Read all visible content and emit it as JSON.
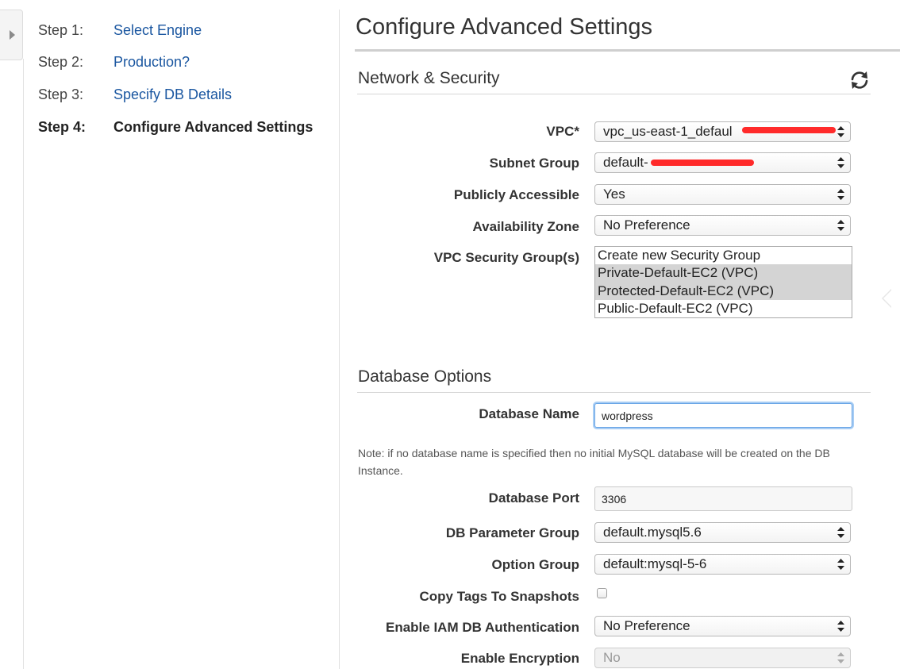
{
  "wizard": {
    "steps": [
      {
        "num": "Step 1:",
        "label": "Select Engine"
      },
      {
        "num": "Step 2:",
        "label": "Production?"
      },
      {
        "num": "Step 3:",
        "label": "Specify DB Details"
      },
      {
        "num": "Step 4:",
        "label": "Configure Advanced Settings"
      }
    ],
    "current_step": 4
  },
  "page": {
    "title": "Configure Advanced Settings"
  },
  "network_security": {
    "title": "Network & Security",
    "refresh_icon": "refresh-icon",
    "vpc": {
      "label": "VPC*",
      "value": "vpc_us-east-1_defaul"
    },
    "subnet_group": {
      "label": "Subnet Group",
      "value": "default-"
    },
    "publicly_accessible": {
      "label": "Publicly Accessible",
      "value": "Yes"
    },
    "availability_zone": {
      "label": "Availability Zone",
      "value": "No Preference"
    },
    "vpc_security_groups": {
      "label": "VPC Security Group(s)",
      "options": [
        {
          "text": "Create new Security Group",
          "selected": false
        },
        {
          "text": "Private-Default-EC2 (VPC)",
          "selected": true
        },
        {
          "text": "Protected-Default-EC2 (VPC)",
          "selected": true
        },
        {
          "text": "Public-Default-EC2 (VPC)",
          "selected": false
        }
      ]
    }
  },
  "database_options": {
    "title": "Database Options",
    "database_name": {
      "label": "Database Name",
      "value": "wordpress"
    },
    "note": "Note: if no database name is specified then no initial MySQL database will be created on the DB Instance.",
    "database_port": {
      "label": "Database Port",
      "value": "3306"
    },
    "db_parameter_group": {
      "label": "DB Parameter Group",
      "value": "default.mysql5.6"
    },
    "option_group": {
      "label": "Option Group",
      "value": "default:mysql-5-6"
    },
    "copy_tags": {
      "label": "Copy Tags To Snapshots",
      "checked": false
    },
    "iam_auth": {
      "label": "Enable IAM DB Authentication",
      "value": "No Preference"
    },
    "encryption": {
      "label": "Enable Encryption",
      "value": "No",
      "disabled": true
    }
  },
  "colors": {
    "link": "#1a56a0",
    "focus_ring": "#a8cdf4",
    "redaction": "#ff2a2a"
  }
}
